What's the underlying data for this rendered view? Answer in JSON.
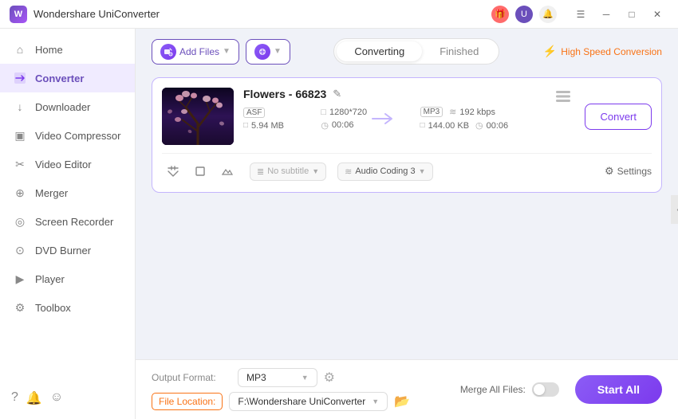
{
  "titleBar": {
    "appName": "Wondershare UniConverter",
    "icons": {
      "gift": "🎁",
      "user": "U",
      "bell": "🔔",
      "menu": "☰",
      "minimize": "─",
      "maximize": "□",
      "close": "✕"
    }
  },
  "sidebar": {
    "items": [
      {
        "id": "home",
        "label": "Home",
        "icon": "⌂"
      },
      {
        "id": "converter",
        "label": "Converter",
        "icon": "⚡",
        "active": true
      },
      {
        "id": "downloader",
        "label": "Downloader",
        "icon": "↓"
      },
      {
        "id": "video-compressor",
        "label": "Video Compressor",
        "icon": "▣"
      },
      {
        "id": "video-editor",
        "label": "Video Editor",
        "icon": "✂"
      },
      {
        "id": "merger",
        "label": "Merger",
        "icon": "⊕"
      },
      {
        "id": "screen-recorder",
        "label": "Screen Recorder",
        "icon": "◎"
      },
      {
        "id": "dvd-burner",
        "label": "DVD Burner",
        "icon": "⊙"
      },
      {
        "id": "player",
        "label": "Player",
        "icon": "▶"
      },
      {
        "id": "toolbox",
        "label": "Toolbox",
        "icon": "⚙"
      }
    ],
    "bottomIcons": [
      "?",
      "🔔",
      "☺"
    ]
  },
  "topBar": {
    "addFileLabel": "Add Files",
    "tabs": {
      "converting": "Converting",
      "finished": "Finished"
    },
    "activeTab": "converting",
    "highSpeedLabel": "High Speed Conversion"
  },
  "fileCard": {
    "fileName": "Flowers - 66823",
    "source": {
      "format": "ASF",
      "fileSize": "5.94 MB",
      "resolution": "1280*720",
      "duration": "00:06"
    },
    "target": {
      "format": "MP3",
      "fileSize": "144.00 KB",
      "bitrate": "192 kbps",
      "duration": "00:06"
    },
    "subtitle": "No subtitle",
    "audioCoding": "Audio Coding 3",
    "settingsLabel": "Settings",
    "convertLabel": "Convert"
  },
  "bottomBar": {
    "outputFormatLabel": "Output Format:",
    "outputFormat": "MP3",
    "fileLocationLabel": "File Location:",
    "fileLocationPath": "F:\\Wondershare UniConverter",
    "mergeAllLabel": "Merge All Files:",
    "startAllLabel": "Start All"
  }
}
